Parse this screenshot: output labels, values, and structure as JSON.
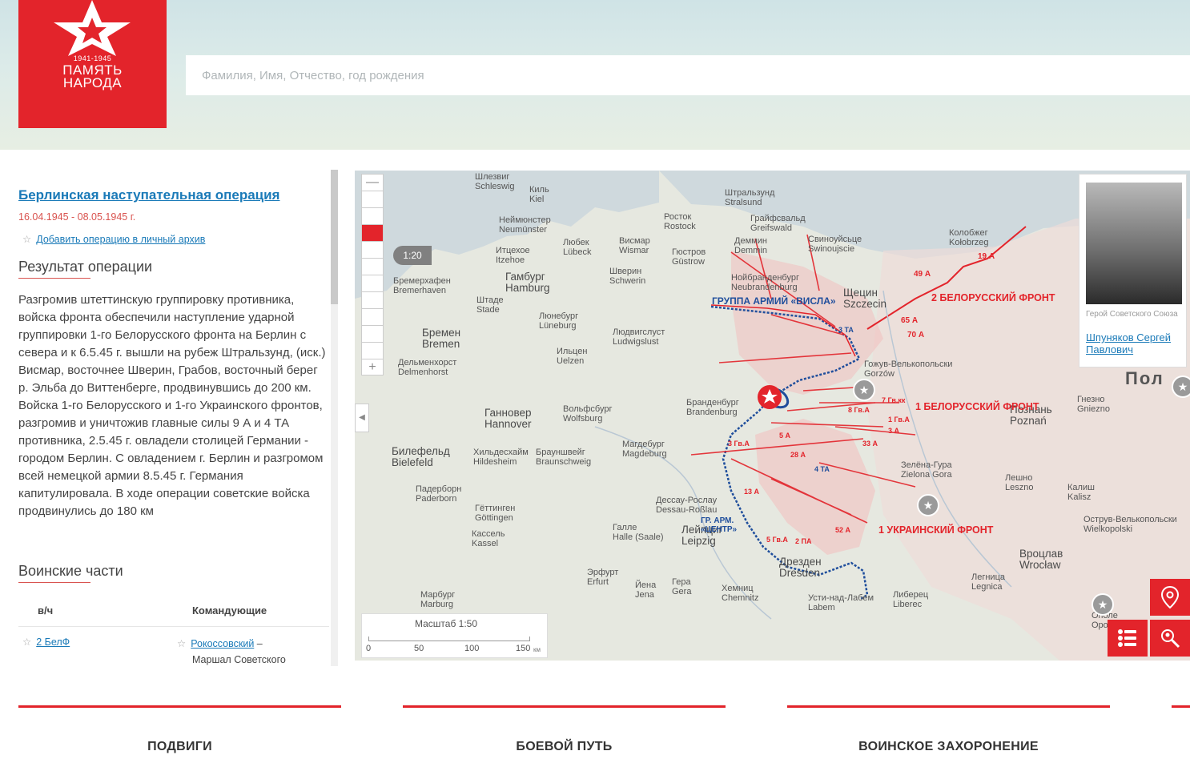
{
  "header": {
    "logo_years": "1941-1945",
    "logo_line1": "ПАМЯТЬ",
    "logo_line2": "НАРОДА",
    "search_placeholder": "Фамилия, Имя, Отчество, год рождения"
  },
  "operation": {
    "title": "Берлинская наступательная операция",
    "dates": "16.04.1945 - 08.05.1945 г.",
    "add_archive": "Добавить операцию в личный архив",
    "result_heading": "Результат операции",
    "result_text": "Разгромив штеттинскую группировку противника, войска фронта обеспечили наступление ударной группировки 1-го Белорусского фронта на Берлин с севера и к 6.5.45 г. вышли на рубеж Штральзунд, (иск.) Висмар, восточнее Шверин, Грабов, восточный берег р. Эльба до Виттенберге, продвинувшись до 200 км. Войска 1-го Белорусского и 1-го Украинского фронтов, разгромив и уничтожив главные силы 9 А и 4 ТА противника, 2.5.45 г. овладели столицей Германии - городом Берлин. С овладением г. Берлин и разгромом всей немецкой армии 8.5.45 г. Германия капитулировала. В ходе операции советские войска продвинулись до 180 км",
    "units_heading": "Воинские части",
    "units_col1": "в/ч",
    "units_col2": "Командующие",
    "unit_name": "2 БелФ",
    "commander_name": "Рокоссовский",
    "commander_dash": "–",
    "commander_rank": "Маршал Советского"
  },
  "map": {
    "zoom_level": "1:20",
    "zoom_plus": "+",
    "zoom_minus": "—",
    "scale_title": "Масштаб 1:50",
    "scale_ticks": [
      "0",
      "50",
      "100",
      "150"
    ],
    "scale_unit": "км",
    "fronts": {
      "f2": "2 БЕЛОРУССКИЙ ФРОНТ",
      "f1b": "1 БЕЛОРУССКИЙ ФРОНТ",
      "f1u": "1 УКРАИНСКИЙ ФРОНТ"
    },
    "army_groups": {
      "visla": "ГРУППА АРМИЙ «ВИСЛА»",
      "center_line1": "ГР. АРМ.",
      "center_line2": "«ЦЕНТР»"
    },
    "armies": [
      "19 А",
      "65 А",
      "70 А",
      "49 А",
      "3 ТА",
      "7 Гв.кк",
      "8 Гв.А",
      "1 Гв.А",
      "33 А",
      "3 А",
      "4 ТА",
      "28 А",
      "13 А",
      "5 Гв.А",
      "2 ПА",
      "52 А",
      "3 Гв.А",
      "5 А"
    ],
    "country": "Пол",
    "hero": {
      "role": "Герой Советского Союза",
      "name": "Шпуняков Сергей Павлович"
    },
    "cities": [
      {
        "ru": "Шлезвиг",
        "de": "Schleswig"
      },
      {
        "ru": "Киль",
        "de": "Kiel"
      },
      {
        "ru": "Неймюнстер",
        "de": "Neumünster"
      },
      {
        "ru": "Итцехое",
        "de": "Itzehoe"
      },
      {
        "ru": "Любек",
        "de": "Lübeck"
      },
      {
        "ru": "Висмар",
        "de": "Wismar"
      },
      {
        "ru": "Росток",
        "de": "Rostock"
      },
      {
        "ru": "Гюстров",
        "de": "Güstrow"
      },
      {
        "ru": "Штральзунд",
        "de": "Stralsund"
      },
      {
        "ru": "Грайфсвальд",
        "de": "Greifswald"
      },
      {
        "ru": "Деммин",
        "de": "Demmin"
      },
      {
        "ru": "Свиноуйсьце",
        "de": "Swinoujscie"
      },
      {
        "ru": "Гамбург",
        "de": "Hamburg"
      },
      {
        "ru": "Шверин",
        "de": "Schwerin"
      },
      {
        "ru": "Бремерхафен",
        "de": "Bremerhaven"
      },
      {
        "ru": "Штаде",
        "de": "Stade"
      },
      {
        "ru": "Люнебург",
        "de": "Lüneburg"
      },
      {
        "ru": "Нойбранденбург",
        "de": "Neubrandenburg"
      },
      {
        "ru": "Щецин",
        "de": "Szczecin"
      },
      {
        "ru": "Бремен",
        "de": "Bremen"
      },
      {
        "ru": "Ильцен",
        "de": "Uelzen"
      },
      {
        "ru": "Людвигслуст",
        "de": "Ludwigslust"
      },
      {
        "ru": "Дельменхорст",
        "de": "Delmenhorst"
      },
      {
        "ru": "Ганновер",
        "de": "Hannover"
      },
      {
        "ru": "Вольфсбург",
        "de": "Wolfsburg"
      },
      {
        "ru": "Бранденбург",
        "de": "Brandenburg"
      },
      {
        "ru": "Магдебург",
        "de": "Magdeburg"
      },
      {
        "ru": "Билефельд",
        "de": "Bielefeld"
      },
      {
        "ru": "Хильдесхайм",
        "de": "Hildesheim"
      },
      {
        "ru": "Брауншвейг",
        "de": "Braunschweig"
      },
      {
        "ru": "Падерборн",
        "de": "Paderborn"
      },
      {
        "ru": "Гёттинген",
        "de": "Göttingen"
      },
      {
        "ru": "Кассель",
        "de": "Kassel"
      },
      {
        "ru": "Лейпциг",
        "de": "Leipzig"
      },
      {
        "ru": "Галле",
        "de": "Halle (Saale)"
      },
      {
        "ru": "Дессау-Рослау",
        "de": "Dessau-Roßlau"
      },
      {
        "ru": "Дрезден",
        "de": "Dresden"
      },
      {
        "ru": "Хемниц",
        "de": "Chemnitz"
      },
      {
        "ru": "Эрфурт",
        "de": "Erfurt"
      },
      {
        "ru": "Йена",
        "de": "Jena"
      },
      {
        "ru": "Гера",
        "de": "Gera"
      },
      {
        "ru": "Марбург",
        "de": "Marburg"
      },
      {
        "ru": "Колобжег",
        "de": "Kołobrzeg"
      },
      {
        "ru": "Познань",
        "de": "Poznań"
      },
      {
        "ru": "Гнезно",
        "de": "Gniezno"
      },
      {
        "ru": "Зелёна-Гура",
        "de": "Zielona Gora"
      },
      {
        "ru": "Вроцлав",
        "de": "Wrocław"
      },
      {
        "ru": "Либерец",
        "de": "Liberec"
      },
      {
        "ru": "Усти-над-Лабем",
        "de": "Labem"
      },
      {
        "ru": "Гожув-Велькопольски",
        "de": "Gorzów"
      },
      {
        "ru": "Легница",
        "de": "Legnica"
      },
      {
        "ru": "Лешно",
        "de": "Leszno"
      },
      {
        "ru": "Калиш",
        "de": "Kalisz"
      },
      {
        "ru": "Острув-Велькопольски",
        "de": "Wielkopolski"
      },
      {
        "ru": "Ополе",
        "de": "Opole"
      }
    ]
  },
  "tabs": [
    "ПОДВИГИ",
    "БОЕВОЙ ПУТЬ",
    "ВОИНСКОЕ ЗАХОРОНЕНИЕ"
  ],
  "colors": {
    "accent": "#e3242b",
    "link": "#1a7ab8",
    "front": "#e3242b",
    "enemy": "#1f4e9c"
  }
}
